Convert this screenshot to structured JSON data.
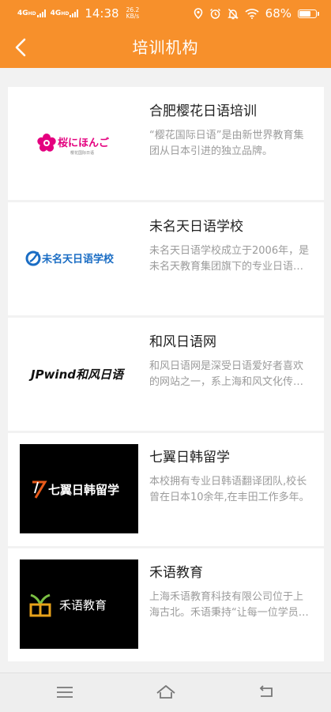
{
  "status_bar": {
    "signal1": "4G",
    "signal1_sup": "HD",
    "signal2": "4G",
    "signal2_sup": "HD",
    "time": "14:38",
    "net_speed_value": "26.2",
    "net_speed_unit": "KB/s",
    "battery": "68%"
  },
  "app_bar": {
    "title": "培训机构"
  },
  "institutions": [
    {
      "name": "合肥樱花日语培训",
      "desc": "“樱花国际日语”是由新世界教育集团从日本引进的独立品牌。",
      "logo_main": "桜にほんご",
      "logo_sub": "樱花国际日语"
    },
    {
      "name": "未名天日语学校",
      "desc": "未名天日语学校成立于2006年，是未名天教育集团旗下的专业日语培训学校。",
      "logo_main": "未名天日语学校"
    },
    {
      "name": "和风日语网",
      "desc": " 和风日语网是深受日语爱好者喜欢的网站之一，系上海和风文化传播有限公司旗下网站。",
      "logo_main": "JPwind和风日语"
    },
    {
      "name": "七翼日韩留学",
      "desc": "本校拥有专业日韩语翻译团队,校长曾在日本10余年,在丰田工作多年。",
      "logo_main": "七翼日韩留学"
    },
    {
      "name": "禾语教育",
      "desc": "上海禾语教育科技有限公司位于上海古北。禾语秉持“让每一位学员学有所成”的理念。",
      "logo_main": "禾语教育"
    }
  ],
  "colors": {
    "brand": "#f7902b",
    "sakura": "#e4007f",
    "blue": "#1a6dc4"
  }
}
